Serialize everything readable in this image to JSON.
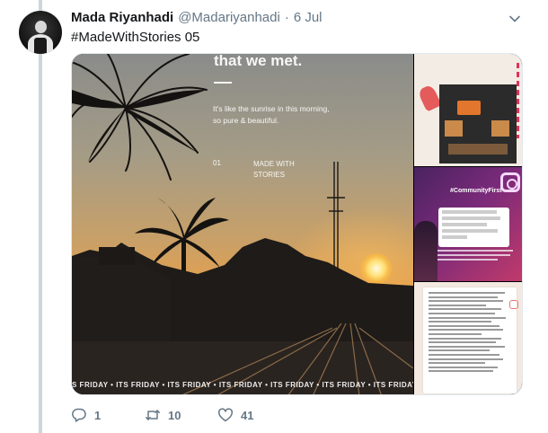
{
  "tweet": {
    "author_name": "Mada Riyanhadi",
    "handle": "@Madariyanhadi",
    "separator": "·",
    "date": "6 Jul",
    "text": "#MadeWithStories 05"
  },
  "media": {
    "main": {
      "headline": "that we met.",
      "body": "It's like the sunrise in this morning, so pure & beautiful.",
      "number": "01",
      "made_with": "MADE WITH STORIES",
      "ticker": "S FRIDAY • ITS FRIDAY • ITS FRIDAY • ITS FRIDAY • ITS FRIDAY • ITS FRIDAY • ITS FRIDAY"
    },
    "thumb2": {
      "tag": "#CommunityFirst"
    }
  },
  "actions": {
    "replies": "1",
    "retweets": "10",
    "likes": "41"
  },
  "icons": {
    "caret": "chevron-down-icon",
    "reply": "reply-icon",
    "retweet": "retweet-icon",
    "like": "heart-icon",
    "instagram": "instagram-icon"
  },
  "colors": {
    "text_primary": "#14171a",
    "text_secondary": "#657786",
    "thread_line": "#ccd6dd"
  }
}
